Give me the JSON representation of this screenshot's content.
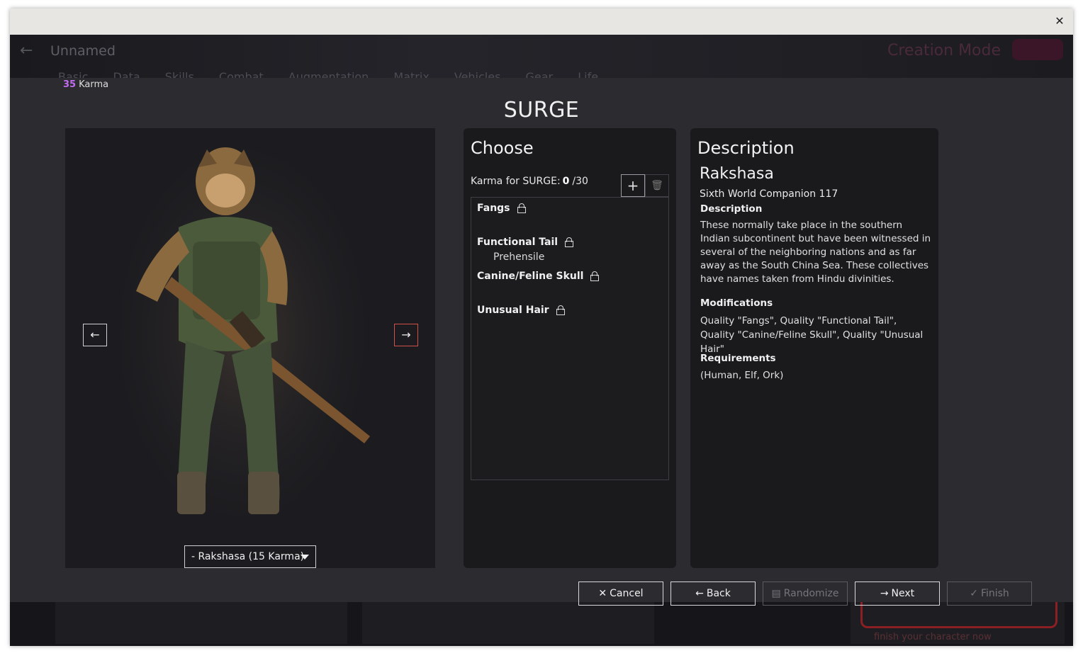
{
  "background_app": {
    "title": "Unnamed",
    "mode": "Creation Mode",
    "tabs": "Basic Data  Skills  Combat  Augmentation  Matrix  Vehicles  Gear  Life",
    "notice": "finish your character now"
  },
  "karma": {
    "value": "35",
    "label": "Karma"
  },
  "dialog": {
    "title": "SURGE"
  },
  "image_panel": {
    "variant_selected": "- Rakshasa (15 Karma)",
    "prev_icon": "arrow-left-icon",
    "next_icon": "arrow-right-icon"
  },
  "choose": {
    "heading": "Choose",
    "karma_label": "Karma for SURGE:",
    "karma_spent": "0",
    "karma_max": "/30",
    "items": [
      {
        "name": "Fangs",
        "sub": ""
      },
      {
        "name": "Functional Tail",
        "sub": "Prehensile"
      },
      {
        "name": "Canine/Feline Skull",
        "sub": ""
      },
      {
        "name": "Unusual Hair",
        "sub": ""
      }
    ]
  },
  "description": {
    "heading": "Description",
    "name": "Rakshasa",
    "source": "Sixth World Companion 117",
    "desc_label": "Description",
    "desc_text": "These normally take place in the southern Indian subcontinent but have been witnessed in several of the neighboring nations and as far away as the South China Sea. These collectives have names taken from Hindu divinities.",
    "mods_label": "Modifications",
    "mods_text": "Quality \"Fangs\", Quality \"Functional Tail\", Quality \"Canine/Feline Skull\", Quality \"Unusual Hair\"",
    "req_label": "Requirements",
    "req_text": "(Human, Elf, Ork)"
  },
  "buttons": {
    "cancel": "Cancel",
    "back": "Back",
    "randomize": "Randomize",
    "next": "Next",
    "finish": "Finish"
  }
}
